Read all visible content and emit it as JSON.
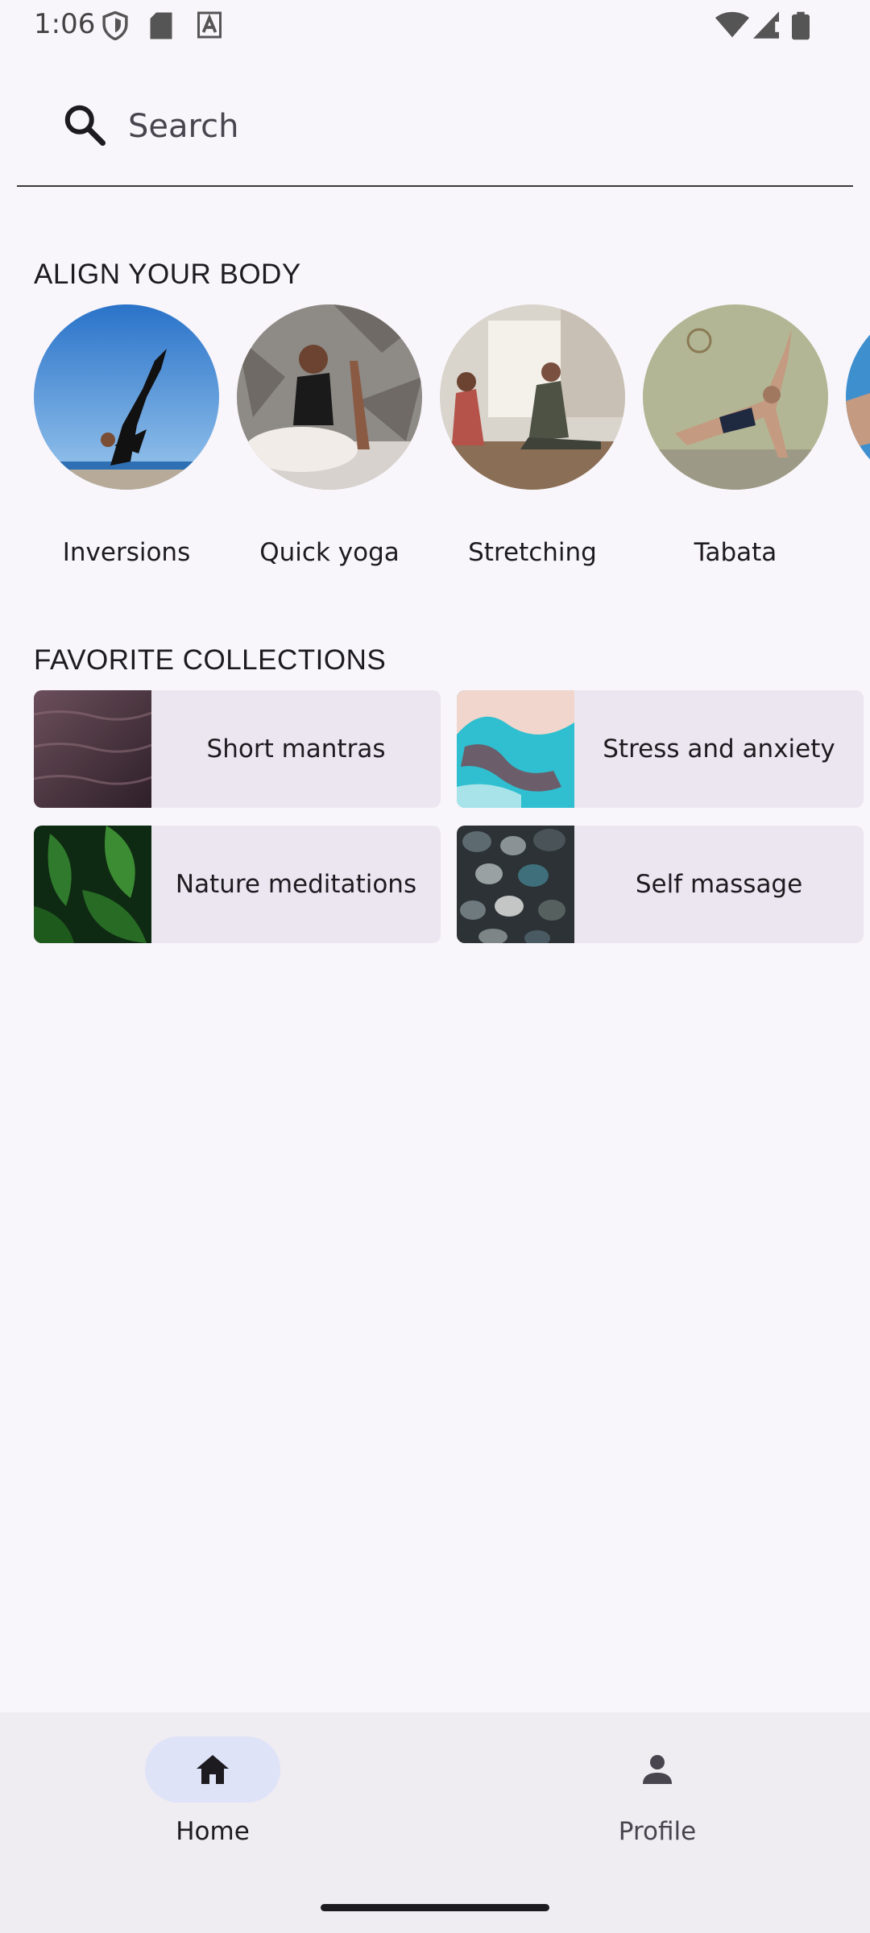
{
  "status_bar": {
    "time": "1:06",
    "left_icons": [
      "shield-icon",
      "sd-card-icon",
      "a-badge-icon"
    ],
    "right_icons": [
      "wifi-icon",
      "cell-signal-icon",
      "battery-icon"
    ]
  },
  "search": {
    "placeholder": "Search",
    "value": "",
    "icon": "search-icon"
  },
  "align_section": {
    "title": "ALIGN YOUR BODY",
    "items": [
      {
        "label": "Inversions"
      },
      {
        "label": "Quick yoga"
      },
      {
        "label": "Stretching"
      },
      {
        "label": "Tabata"
      },
      {
        "label": ""
      }
    ]
  },
  "favorites_section": {
    "title": "FAVORITE COLLECTIONS",
    "items": [
      {
        "label": "Short mantras"
      },
      {
        "label": "Stress and anxiety"
      },
      {
        "label": "Nature meditations"
      },
      {
        "label": "Self massage"
      }
    ]
  },
  "bottom_nav": {
    "items": [
      {
        "label": "Home",
        "icon": "home-icon",
        "selected": true
      },
      {
        "label": "Profile",
        "icon": "person-icon",
        "selected": false
      }
    ]
  },
  "colors": {
    "background": "#f9f6fb",
    "nav_background": "#efecf2",
    "nav_indicator": "#dfe3f8",
    "text": "#1d1b20",
    "muted_text": "#49454f"
  }
}
